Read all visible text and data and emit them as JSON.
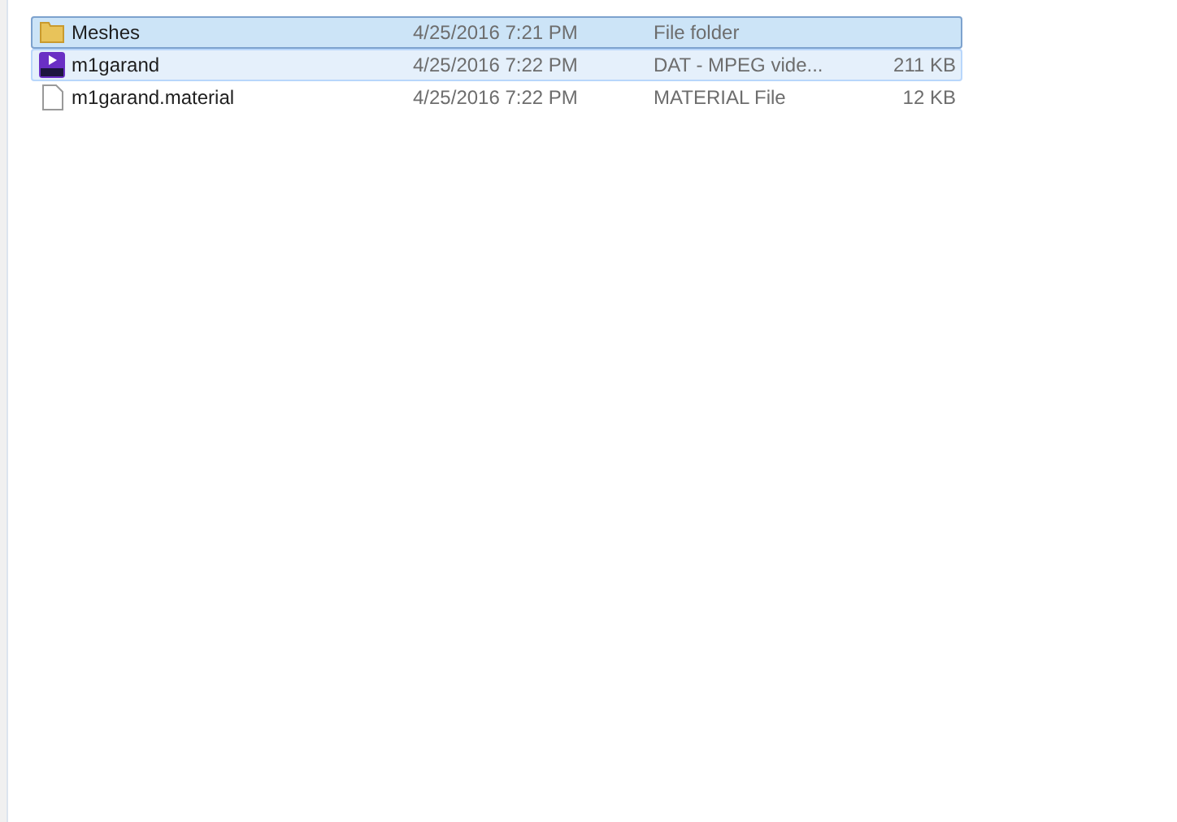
{
  "files": [
    {
      "kind": "folder",
      "name": "Meshes",
      "date": "4/25/2016 7:21 PM",
      "type": "File folder",
      "selected": true,
      "highlighted": false
    },
    {
      "kind": "video",
      "name": "m1garand",
      "date": "4/25/2016 7:22 PM",
      "type": "DAT - MPEG vide...",
      "size": "211 KB",
      "selected": false,
      "highlighted": true
    },
    {
      "kind": "file",
      "name": "m1garand.material",
      "date": "4/25/2016 7:22 PM",
      "type": "MATERIAL File",
      "size": "12 KB",
      "selected": false,
      "highlighted": false
    }
  ]
}
